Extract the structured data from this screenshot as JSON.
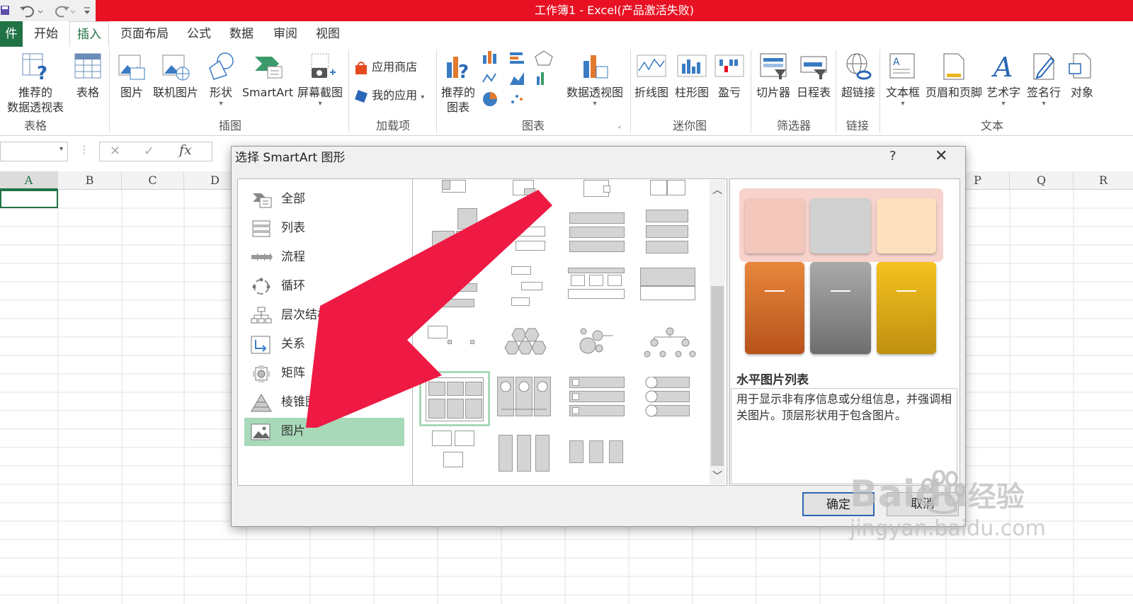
{
  "window": {
    "title": "工作簿1 -  Excel(产品激活失败)"
  },
  "ribbon_tabs": [
    "件",
    "开始",
    "插入",
    "页面布局",
    "公式",
    "数据",
    "审阅",
    "视图"
  ],
  "ribbon": {
    "groups": {
      "tables": "表格",
      "illustrations": "插图",
      "addins": "加载项",
      "charts": "图表",
      "sparklines": "迷你图",
      "filters": "筛选器",
      "links": "链接",
      "text": "文本"
    },
    "buttons": {
      "recommended_pivot": "推荐的 数据透视表",
      "recommended_pivot_line1": "推荐的",
      "recommended_pivot_line2": "数据透视表",
      "table": "表格",
      "picture": "图片",
      "online_picture": "联机图片",
      "shapes": "形状",
      "smartart": "SmartArt",
      "screenshot": "屏幕截图",
      "store": "应用商店",
      "my_apps": "我的应用",
      "recommended_charts_line1": "推荐的",
      "recommended_charts_line2": "图表",
      "pivot_chart": "数据透视图",
      "line": "折线图",
      "column": "柱形图",
      "winloss": "盈亏",
      "slicer": "切片器",
      "timeline": "日程表",
      "hyperlink": "超链接",
      "textbox": "文本框",
      "header_footer": "页眉和页脚",
      "wordart": "艺术字",
      "signature": "签名行",
      "object": "对象"
    }
  },
  "formula_bar": {
    "fx": "fx",
    "cancel": "✕",
    "enter": "✓"
  },
  "columns": [
    "A",
    "B",
    "C",
    "D",
    "P",
    "Q",
    "R"
  ],
  "dialog": {
    "title": "选择 SmartArt 图形",
    "help": "?",
    "close": "✕",
    "categories": [
      "全部",
      "列表",
      "流程",
      "循环",
      "层次结构",
      "关系",
      "矩阵",
      "棱锥图",
      "图片"
    ],
    "selected_category": "图片",
    "preview_title": "水平图片列表",
    "preview_description": "用于显示非有序信息或分组信息，并强调相关图片。顶层形状用于包含图片。",
    "preview_colors": {
      "top": [
        "#f4c7bd",
        "#d0d0d0",
        "#fde0bd"
      ],
      "bottom": [
        "#e2792f",
        "#9a9a9a",
        "#e8b51e"
      ],
      "frame": "#f7d3cc"
    },
    "ok": "确定",
    "cancel": "取消"
  },
  "annotation": {
    "arrow_color": "#ee1a43"
  },
  "watermark": {
    "brand": "Baidu",
    "product": "经验",
    "url": "jingyan.baidu.com"
  }
}
